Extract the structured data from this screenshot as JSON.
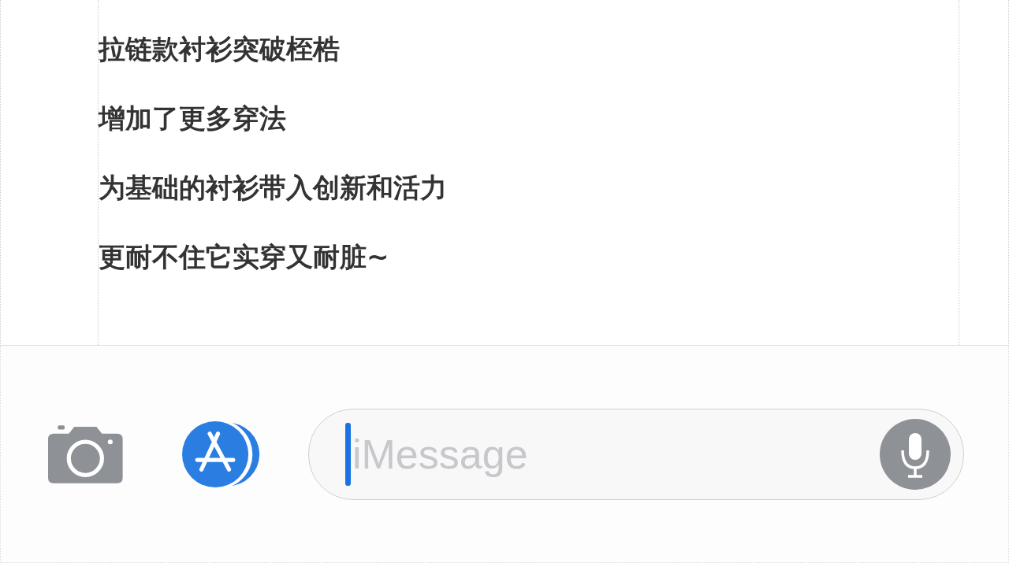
{
  "message_lines": [
    "拉链款衬衫突破桎梏",
    "增加了更多穿法",
    "为基础的衬衫带入创新和活力",
    "更耐不住它实穿又耐脏~"
  ],
  "input_bar": {
    "placeholder": "iMessage"
  }
}
